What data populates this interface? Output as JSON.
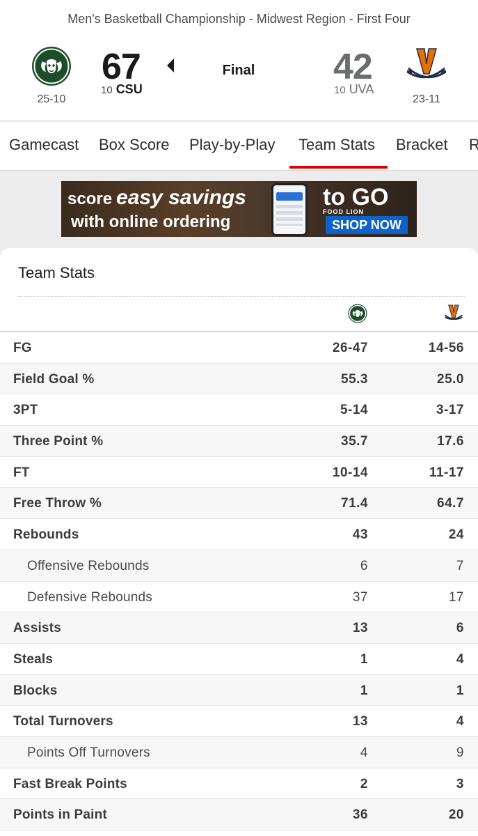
{
  "header": {
    "event_title": "Men's Basketball Championship - Midwest Region - First Four",
    "status": "Final",
    "home": {
      "score": "67",
      "seed": "10",
      "abbr": "CSU",
      "record": "25-10",
      "logo": "rams-head-logo",
      "color": "#1e4d2b"
    },
    "away": {
      "score": "42",
      "seed": "10",
      "abbr": "UVA",
      "record": "23-11",
      "logo": "crossed-sabres-v-logo",
      "color": "#232d4b",
      "accent": "#e57200"
    },
    "winner_indicator": "left-arrow-icon"
  },
  "tabs": {
    "items": [
      {
        "label": "Gamecast"
      },
      {
        "label": "Box Score"
      },
      {
        "label": "Play-by-Play"
      },
      {
        "label": "Team Stats"
      },
      {
        "label": "Bracket"
      },
      {
        "label": "R"
      }
    ],
    "active": "Team Stats",
    "active_color": "#dd0000"
  },
  "ad": {
    "line1_prefix": "score",
    "line1_rest": "easy savings",
    "line2": "with online ordering",
    "brand": "to GO",
    "brand_small": "FOOD LION",
    "cta": "SHOP NOW"
  },
  "stats": {
    "title": "Team Stats",
    "rows": [
      {
        "label": "FG",
        "csu": "26-47",
        "uva": "14-56",
        "sub": false
      },
      {
        "label": "Field Goal %",
        "csu": "55.3",
        "uva": "25.0",
        "sub": false
      },
      {
        "label": "3PT",
        "csu": "5-14",
        "uva": "3-17",
        "sub": false
      },
      {
        "label": "Three Point %",
        "csu": "35.7",
        "uva": "17.6",
        "sub": false
      },
      {
        "label": "FT",
        "csu": "10-14",
        "uva": "11-17",
        "sub": false
      },
      {
        "label": "Free Throw %",
        "csu": "71.4",
        "uva": "64.7",
        "sub": false
      },
      {
        "label": "Rebounds",
        "csu": "43",
        "uva": "24",
        "sub": false
      },
      {
        "label": "Offensive Rebounds",
        "csu": "6",
        "uva": "7",
        "sub": true
      },
      {
        "label": "Defensive Rebounds",
        "csu": "37",
        "uva": "17",
        "sub": true
      },
      {
        "label": "Assists",
        "csu": "13",
        "uva": "6",
        "sub": false
      },
      {
        "label": "Steals",
        "csu": "1",
        "uva": "4",
        "sub": false
      },
      {
        "label": "Blocks",
        "csu": "1",
        "uva": "1",
        "sub": false
      },
      {
        "label": "Total Turnovers",
        "csu": "13",
        "uva": "4",
        "sub": false
      },
      {
        "label": "Points Off Turnovers",
        "csu": "4",
        "uva": "9",
        "sub": true
      },
      {
        "label": "Fast Break Points",
        "csu": "2",
        "uva": "3",
        "sub": false
      },
      {
        "label": "Points in Paint",
        "csu": "36",
        "uva": "20",
        "sub": false
      }
    ]
  }
}
